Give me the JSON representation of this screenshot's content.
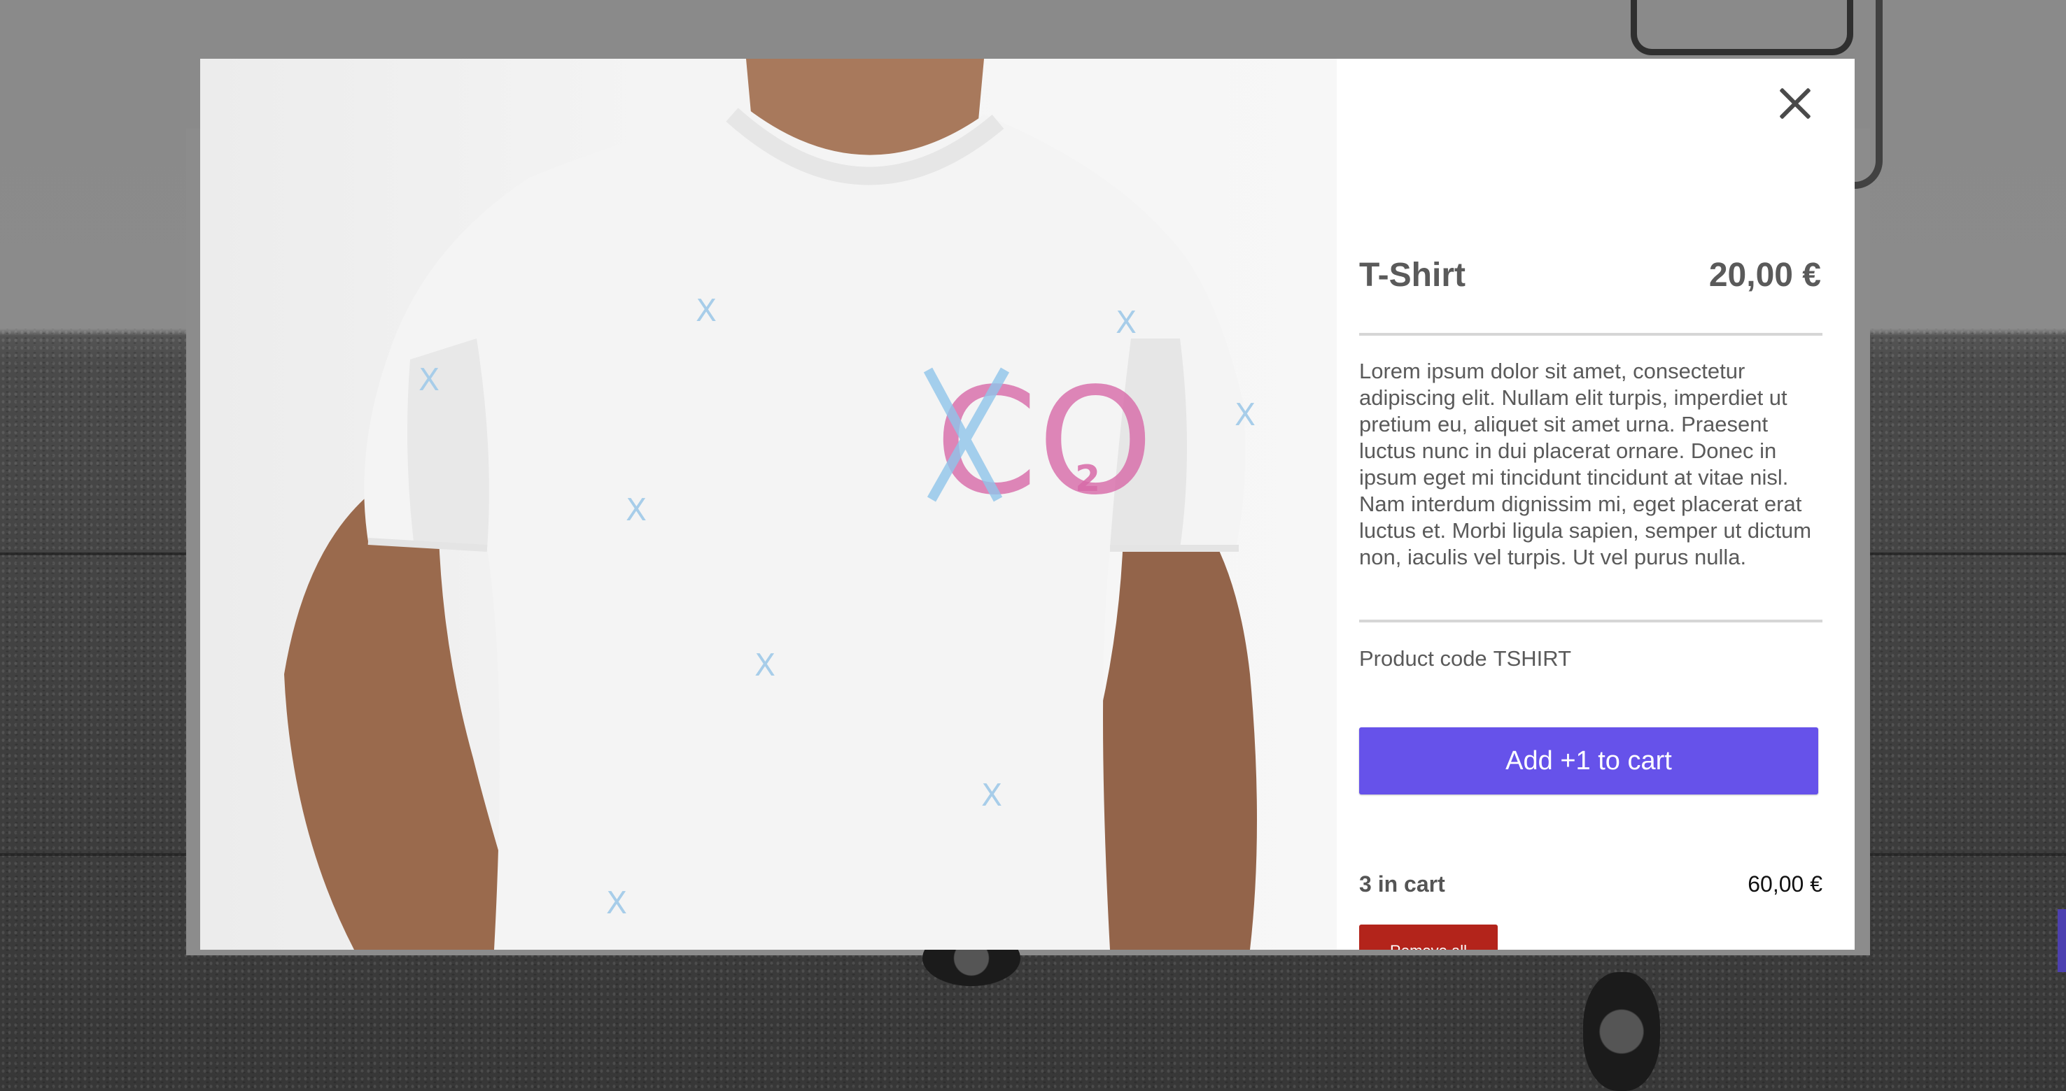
{
  "product": {
    "title": "T-Shirt",
    "price": "20,00 €",
    "description": "Lorem ipsum dolor sit amet, consectetur adipiscing elit. Nullam elit turpis, imperdiet ut pretium eu, aliquet sit amet urna. Praesent luctus nunc in dui placerat ornare. Donec in ipsum eget mi tincidunt tincidunt at vitae nisl. Nam interdum dignissim mi, eget placerat erat luctus et. Morbi ligula sapien, semper ut dictum non, iaculis vel turpis. Ut vel purus nulla.",
    "code_label": "Product code",
    "code": "TSHIRT",
    "image_print": {
      "letters": "CO",
      "subscript": "2",
      "pattern_glyph": "X"
    }
  },
  "actions": {
    "add_label": "Add +1 to cart",
    "remove_label": "Remove all",
    "close_icon": "close-icon"
  },
  "cart": {
    "count_text": "3 in cart",
    "total": "60,00 €"
  },
  "colors": {
    "accent": "#6652ea",
    "danger": "#b3241b",
    "print_pink": "#d86aa8",
    "print_blue": "#8fc4ea"
  }
}
